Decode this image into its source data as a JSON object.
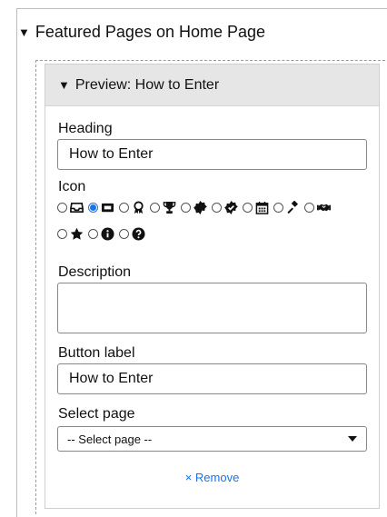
{
  "section": {
    "title": "Featured Pages on Home Page"
  },
  "preview": {
    "title": "Preview: How to Enter"
  },
  "heading": {
    "label": "Heading",
    "value": "How to Enter"
  },
  "icon": {
    "label": "Icon",
    "selected": "ticket-icon",
    "options": [
      "inbox-icon",
      "ticket-icon",
      "award-icon",
      "trophy-icon",
      "badge-icon",
      "check-badge-icon",
      "calendar-icon",
      "gavel-icon",
      "handshake-icon",
      "star-icon",
      "info-icon",
      "question-icon"
    ]
  },
  "description": {
    "label": "Description",
    "value": ""
  },
  "button": {
    "label": "Button label",
    "value": "How to Enter"
  },
  "select_page": {
    "label": "Select page",
    "value": "-- Select page --"
  },
  "remove": {
    "label": "× Remove"
  },
  "colors": {
    "accent": "#1a73e8",
    "header_bg": "#e6e6e6"
  }
}
